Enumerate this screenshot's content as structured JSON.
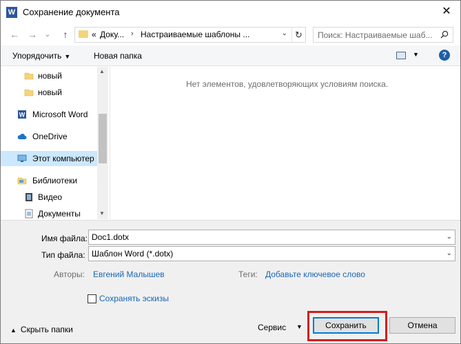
{
  "window": {
    "title": "Сохранение документа",
    "title_icon": "W",
    "close_glyph": "✕"
  },
  "nav": {
    "back_glyph": "←",
    "forward_glyph": "→",
    "dropdown_glyph": "⌄",
    "up_glyph": "↑",
    "address": {
      "prefix": "«",
      "segments": [
        "Доку...",
        "Настраиваемые шаблоны ..."
      ],
      "separator": "›",
      "dropdown_glyph": "⌄",
      "refresh_glyph": "↻"
    },
    "search_placeholder": "Поиск: Настраиваемые шаб..."
  },
  "toolbar": {
    "organize_label": "Упорядочить",
    "organize_caret": "▼",
    "new_folder_label": "Новая папка",
    "view_caret": "▼",
    "help_glyph": "?"
  },
  "navpane": {
    "items": [
      {
        "label": "новый",
        "icon": "folder-icon"
      },
      {
        "label": "новый",
        "icon": "folder-icon"
      },
      {
        "label": "Microsoft Word",
        "icon": "word-icon"
      },
      {
        "label": "OneDrive",
        "icon": "cloud-icon"
      },
      {
        "label": "Этот компьютер",
        "icon": "computer-icon",
        "selected": true
      },
      {
        "label": "Библиотеки",
        "icon": "libraries-icon"
      },
      {
        "label": "Видео",
        "icon": "video-icon"
      },
      {
        "label": "Документы",
        "icon": "documents-icon"
      }
    ],
    "scroll_up_glyph": "▲",
    "scroll_down_glyph": "▼"
  },
  "content": {
    "empty_message": "Нет элементов, удовлетворяющих условиям поиска."
  },
  "form": {
    "filename_label": "Имя файла:",
    "filename_value": "Doc1.dotx",
    "filetype_label": "Тип файла:",
    "filetype_value": "Шаблон Word (*.dotx)",
    "dd_glyph": "⌄",
    "authors_label": "Авторы:",
    "authors_value": "Евгений Малышев",
    "tags_label": "Теги:",
    "tags_value": "Добавьте ключевое слово",
    "thumbnails_label": "Сохранять эскизы",
    "thumbnails_checked": false
  },
  "footer": {
    "hide_folders_glyph": "▲",
    "hide_folders_label": "Скрыть папки",
    "service_label": "Сервис",
    "service_caret": "▼",
    "save_label": "Сохранить",
    "cancel_label": "Отмена"
  },
  "colors": {
    "accent": "#0078d7",
    "link": "#1a66b5",
    "selection": "#cce8ff",
    "highlight_box": "#d41c1c",
    "folder": "#f3d479"
  }
}
